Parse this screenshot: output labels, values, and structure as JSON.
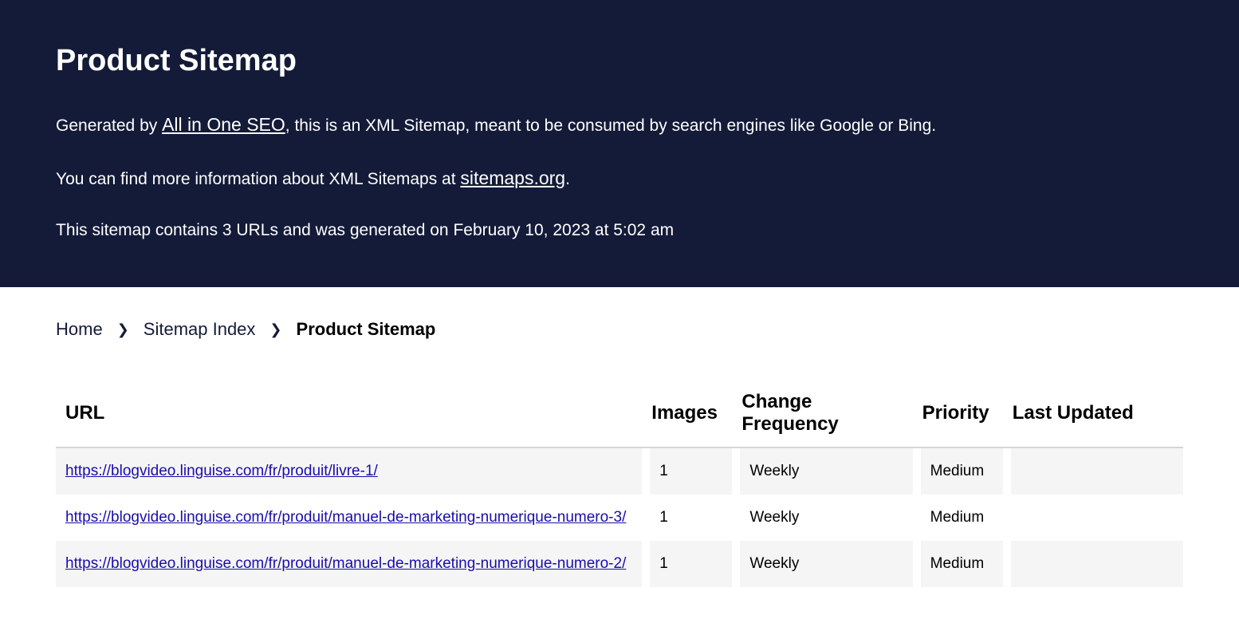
{
  "header": {
    "title": "Product Sitemap",
    "line1_prefix": "Generated by ",
    "line1_link": "All in One SEO",
    "line1_suffix": ", this is an XML Sitemap, meant to be consumed by search engines like Google or Bing.",
    "line2_prefix": "You can find more information about XML Sitemaps at ",
    "line2_link": "sitemaps.org",
    "line2_suffix": ".",
    "line3": "This sitemap contains 3 URLs and was generated on February 10, 2023 at 5:02 am"
  },
  "breadcrumb": {
    "items": [
      "Home",
      "Sitemap Index"
    ],
    "current": "Product Sitemap"
  },
  "table": {
    "columns": [
      "URL",
      "Images",
      "Change Frequency",
      "Priority",
      "Last Updated"
    ],
    "rows": [
      {
        "url": "https://blogvideo.linguise.com/fr/produit/livre-1/",
        "images": "1",
        "change_frequency": "Weekly",
        "priority": "Medium",
        "last_updated": ""
      },
      {
        "url": "https://blogvideo.linguise.com/fr/produit/manuel-de-marketing-numerique-numero-3/",
        "images": "1",
        "change_frequency": "Weekly",
        "priority": "Medium",
        "last_updated": ""
      },
      {
        "url": "https://blogvideo.linguise.com/fr/produit/manuel-de-marketing-numerique-numero-2/",
        "images": "1",
        "change_frequency": "Weekly",
        "priority": "Medium",
        "last_updated": ""
      }
    ]
  }
}
